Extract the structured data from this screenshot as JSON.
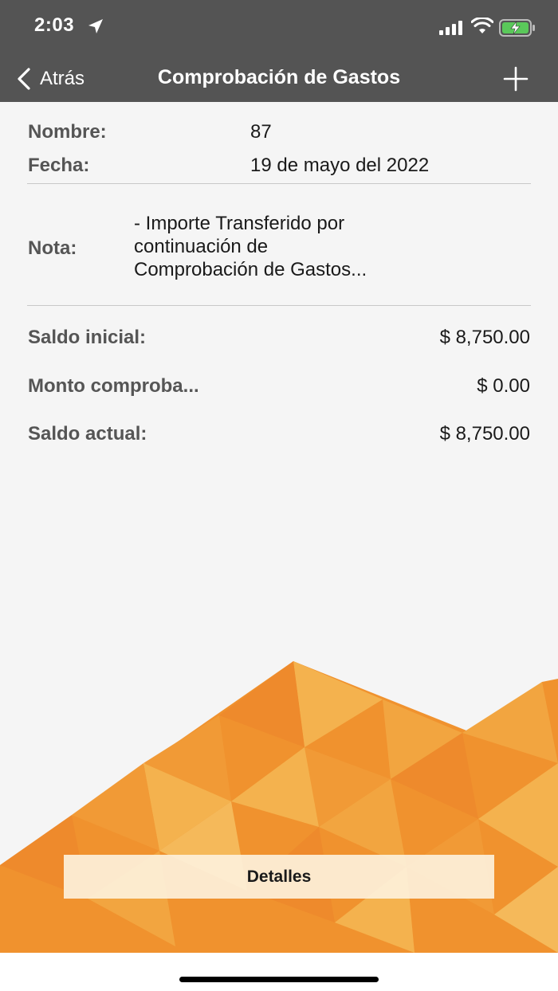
{
  "status_bar": {
    "time": "2:03",
    "icons": [
      "location-arrow-icon",
      "cellular-signal-icon",
      "wifi-icon",
      "battery-charging-icon"
    ]
  },
  "nav": {
    "back_label": "Atrás",
    "title": "Comprobación de Gastos",
    "add_icon": "plus-icon"
  },
  "details": {
    "name_label": "Nombre:",
    "name_value": "87",
    "date_label": "Fecha:",
    "date_value": "19 de mayo del 2022",
    "note_label": "Nota:",
    "note_value": " - Importe Transferido por\ncontinuación de\nComprobación de Gastos..."
  },
  "balances": {
    "initial_label": "Saldo inicial:",
    "initial_value": "$ 8,750.00",
    "verified_label": "Monto comproba...",
    "verified_value": "$ 0.00",
    "current_label": "Saldo actual:",
    "current_value": "$ 8,750.00"
  },
  "actions": {
    "details_button": "Detalles"
  },
  "colors": {
    "bar": "#545454",
    "background": "#f5f5f5",
    "accent_orange": "#f0922e",
    "light_orange": "#f4b24e"
  }
}
